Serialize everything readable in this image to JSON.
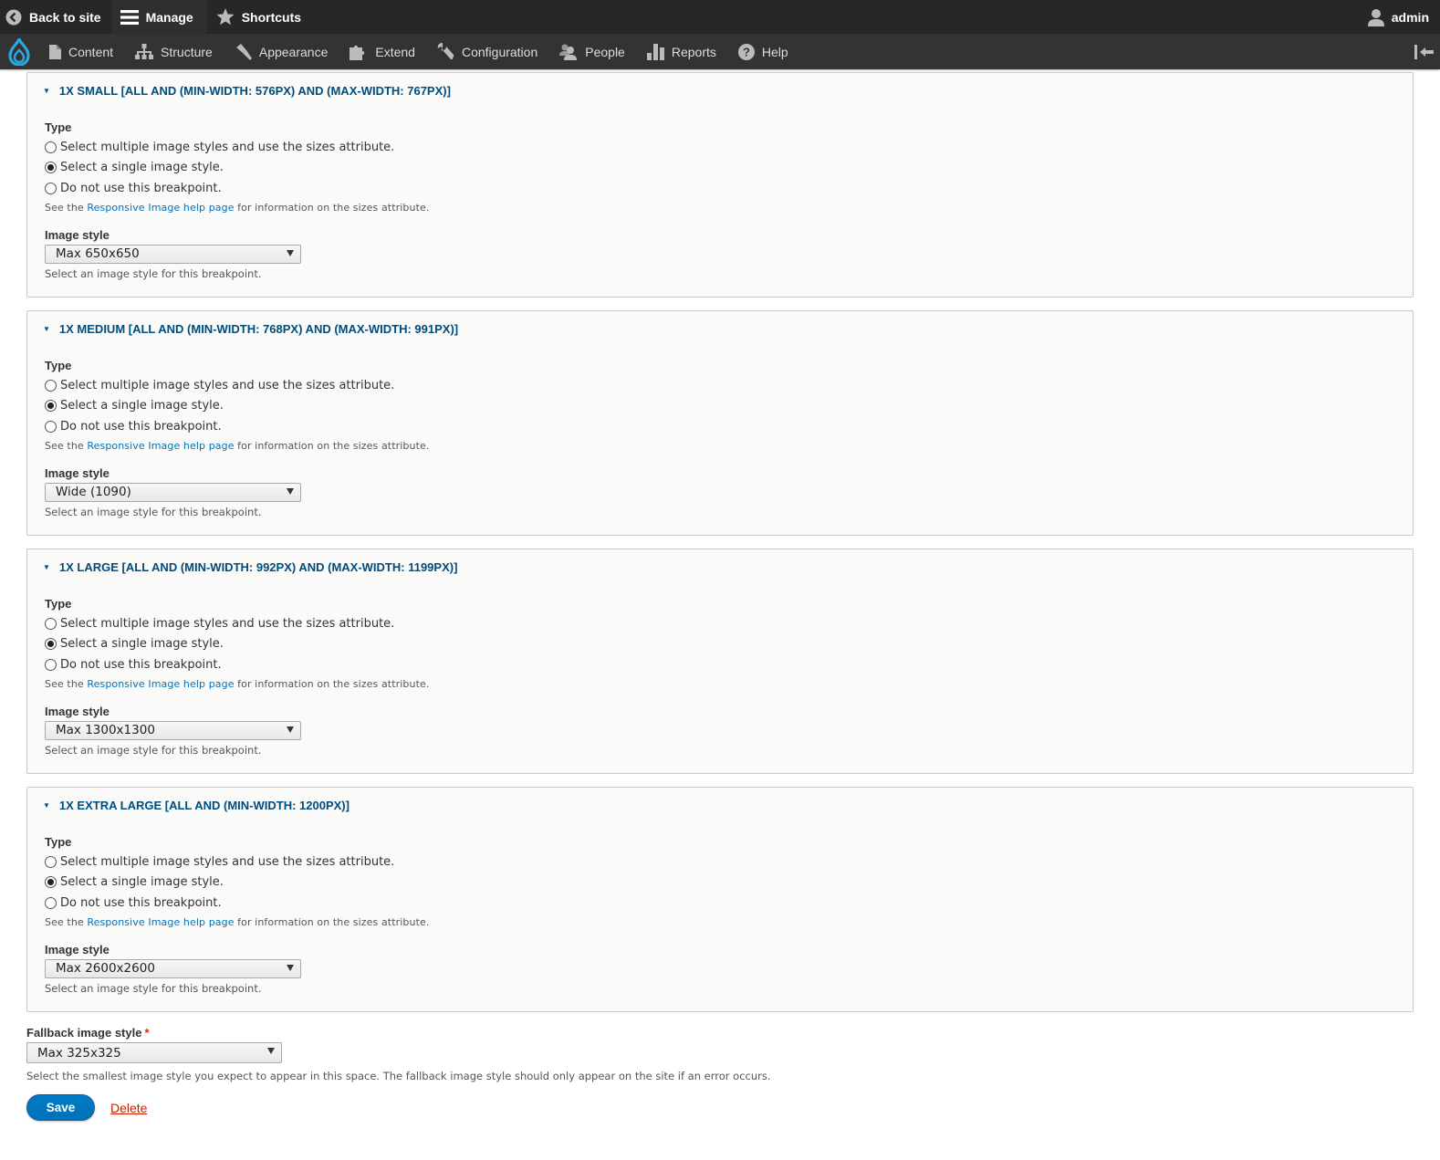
{
  "toolbar": {
    "back_to_site": "Back to site",
    "manage": "Manage",
    "shortcuts": "Shortcuts",
    "user": "admin",
    "tray": [
      {
        "label": "Content",
        "icon": "file-icon"
      },
      {
        "label": "Structure",
        "icon": "sitemap-icon"
      },
      {
        "label": "Appearance",
        "icon": "brush-icon"
      },
      {
        "label": "Extend",
        "icon": "puzzle-icon"
      },
      {
        "label": "Configuration",
        "icon": "wrench-icon"
      },
      {
        "label": "People",
        "icon": "people-icon"
      },
      {
        "label": "Reports",
        "icon": "bar-chart-icon"
      },
      {
        "label": "Help",
        "icon": "help-icon"
      }
    ]
  },
  "colors": {
    "toolbar_bg": "#272727",
    "tray_bg": "#333333",
    "legend": "#004c7d",
    "link": "#0074bd",
    "primary": "#0071b8",
    "danger": "#c72100",
    "drupal_blue": "#29a7de"
  },
  "common": {
    "type_label": "Type",
    "options": [
      "Select multiple image styles and use the sizes attribute.",
      "Select a single image style.",
      "Do not use this breakpoint."
    ],
    "help_prefix": "See the ",
    "help_link": "Responsive Image help page",
    "help_suffix": " for information on the sizes attribute.",
    "style_label": "Image style",
    "style_help": "Select an image style for this breakpoint."
  },
  "breakpoints": [
    {
      "title": "1x Small [all and (min-width: 576px) and (max-width: 767px)]",
      "selected_option": 1,
      "image_style": "Max 650x650"
    },
    {
      "title": "1x Medium [all and (min-width: 768px) and (max-width: 991px)]",
      "selected_option": 1,
      "image_style": "Wide (1090)"
    },
    {
      "title": "1x Large [all and (min-width: 992px) and (max-width: 1199px)]",
      "selected_option": 1,
      "image_style": "Max 1300x1300"
    },
    {
      "title": "1x Extra Large [all and (min-width: 1200px)]",
      "selected_option": 1,
      "image_style": "Max 2600x2600"
    }
  ],
  "fallback": {
    "label": "Fallback image style",
    "required_marker": "*",
    "value": "Max 325x325",
    "help": "Select the smallest image style you expect to appear in this space. The fallback image style should only appear on the site if an error occurs."
  },
  "actions": {
    "save": "Save",
    "delete": "Delete"
  }
}
